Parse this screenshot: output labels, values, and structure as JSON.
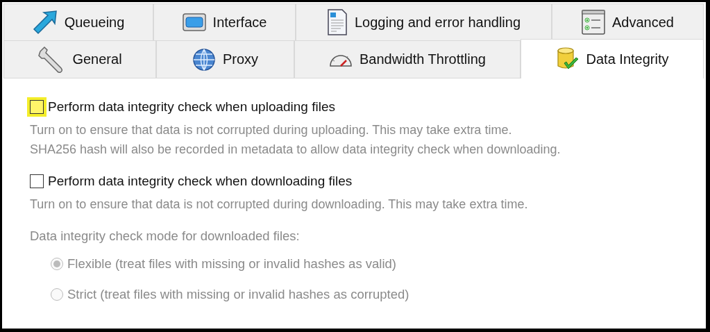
{
  "tab_rows": [
    {
      "tabs": [
        {
          "label": "Queueing",
          "selected": false
        },
        {
          "label": "Interface",
          "selected": false
        },
        {
          "label": "Logging and error handling",
          "selected": false
        },
        {
          "label": "Advanced",
          "selected": false
        }
      ]
    },
    {
      "tabs": [
        {
          "label": "General",
          "selected": false
        },
        {
          "label": "Proxy",
          "selected": false
        },
        {
          "label": "Bandwidth Throttling",
          "selected": false
        },
        {
          "label": "Data Integrity",
          "selected": true
        }
      ]
    }
  ],
  "options": [
    {
      "label": "Perform data integrity check when uploading files",
      "checked": false,
      "focused": true,
      "description": [
        "Turn on to ensure that data is not corrupted during uploading. This may take extra time.",
        "SHA256 hash will also be recorded in metadata to allow data integrity check when downloading."
      ]
    },
    {
      "label": "Perform data integrity check when downloading files",
      "checked": false,
      "focused": false,
      "description": [
        "Turn on to ensure that data is not corrupted during downloading. This may take extra time."
      ]
    }
  ],
  "mode": {
    "label": "Data integrity check mode for downloaded files:",
    "disabled": true,
    "choices": [
      {
        "label": "Flexible (treat files with missing or invalid hashes as valid)",
        "selected": true
      },
      {
        "label": "Strict (treat files with missing or invalid hashes as corrupted)",
        "selected": false
      }
    ]
  }
}
